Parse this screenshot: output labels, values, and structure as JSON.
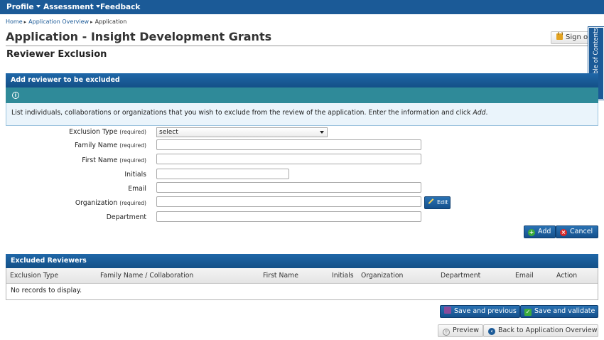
{
  "nav": {
    "profile": "Profile",
    "assessment": "Assessment",
    "feedback": "Feedback"
  },
  "breadcrumb": {
    "home": "Home",
    "overview": "Application Overview",
    "current": "Application"
  },
  "page": {
    "title": "Application - Insight Development Grants",
    "subtitle": "Reviewer Exclusion"
  },
  "signout": "Sign out",
  "toc": "Show Table of Contents",
  "add_panel": {
    "header": "Add reviewer to be excluded",
    "info_text": "List individuals, collaborations or organizations that you wish to exclude from the review of the application. Enter the information and click ",
    "info_emph": "Add",
    "info_end": "."
  },
  "form": {
    "required": "(required)",
    "exclusion_type": {
      "label": "Exclusion Type",
      "value": "select"
    },
    "family_name": {
      "label": "Family Name",
      "value": ""
    },
    "first_name": {
      "label": "First Name",
      "value": ""
    },
    "initials": {
      "label": "Initials",
      "value": ""
    },
    "email": {
      "label": "Email",
      "value": ""
    },
    "organization": {
      "label": "Organization",
      "value": ""
    },
    "department": {
      "label": "Department",
      "value": ""
    },
    "edit_button": "Edit",
    "add_button": "Add",
    "cancel_button": "Cancel"
  },
  "excluded": {
    "header": "Excluded Reviewers",
    "columns": [
      "Exclusion Type",
      "Family Name / Collaboration",
      "First Name",
      "Initials",
      "Organization",
      "Department",
      "Email",
      "Action"
    ],
    "empty_text": "No records to display."
  },
  "footer": {
    "save_previous": "Save and previous",
    "save_validate": "Save and validate",
    "preview": "Preview",
    "back": "Back to Application Overview"
  },
  "colors": {
    "nav_blue": "#1b5a97",
    "teal": "#2f8a99",
    "info_bg": "#eaf4fb"
  }
}
